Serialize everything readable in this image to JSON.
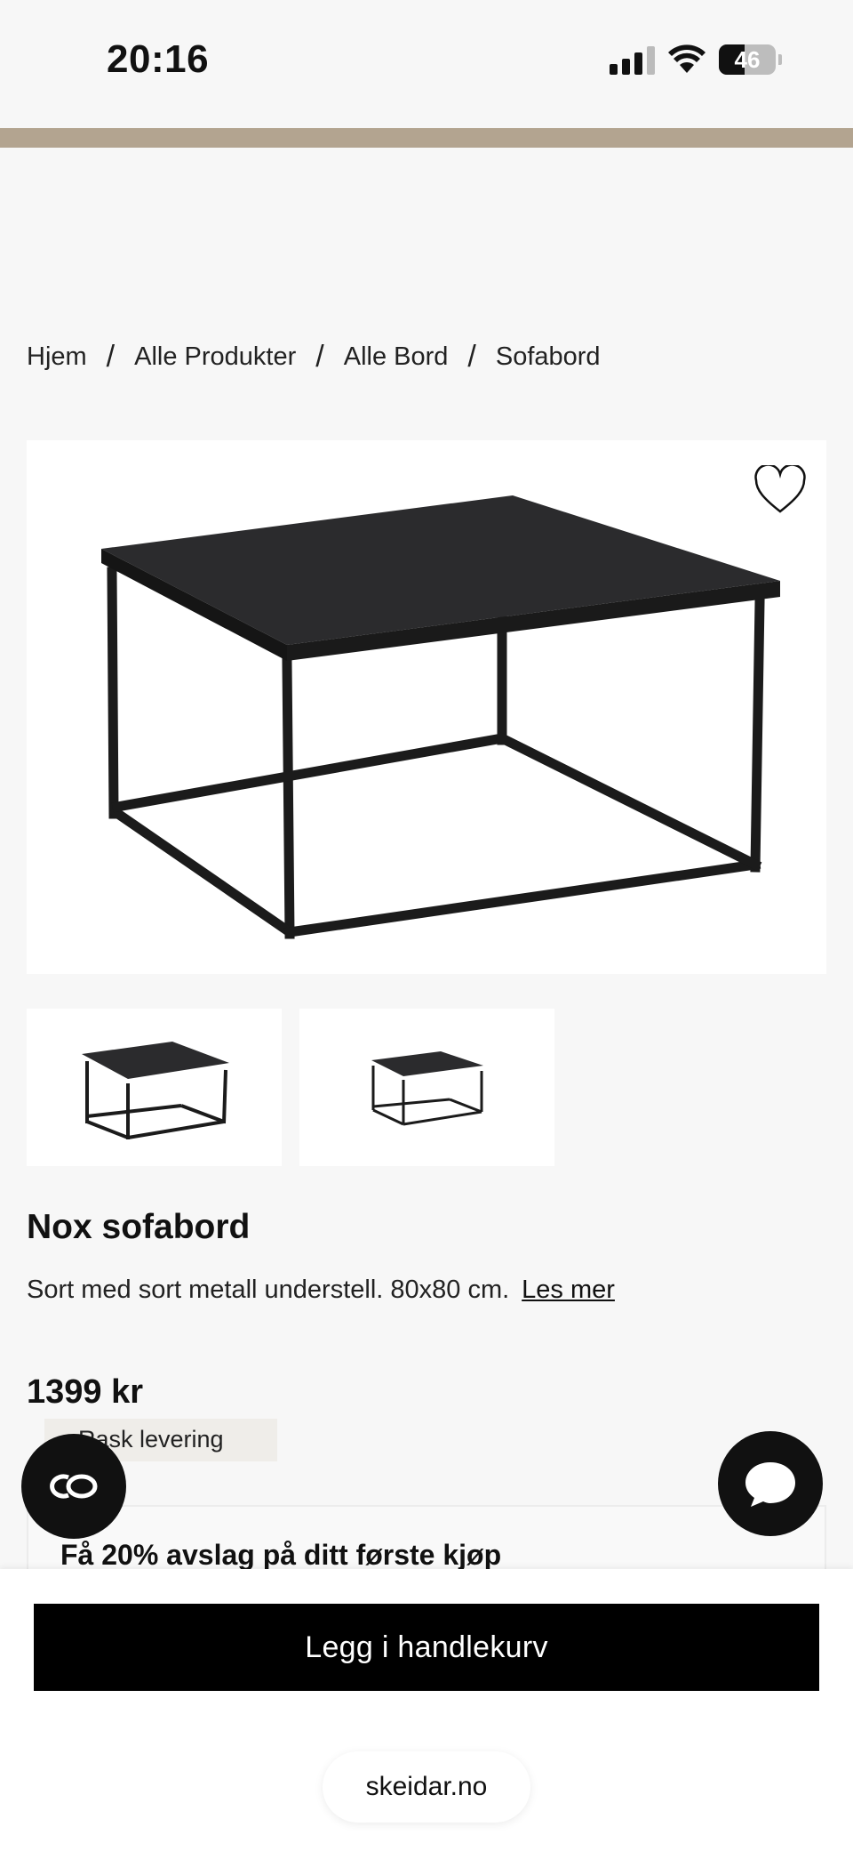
{
  "status_bar": {
    "time": "20:16",
    "battery_level": "46",
    "battery_fraction": 0.46,
    "signal_bars": 4,
    "signal_active": 3
  },
  "accent_color": "#b3a490",
  "breadcrumb": [
    {
      "label": "Hjem"
    },
    {
      "label": "Alle Produkter"
    },
    {
      "label": "Alle Bord"
    },
    {
      "label": "Sofabord"
    }
  ],
  "breadcrumb_separator": "/",
  "product": {
    "title": "Nox sofabord",
    "description": "Sort med sort metall understell. 80x80 cm.",
    "read_more": "Les mer",
    "price": "1399 kr",
    "delivery_badge": "Rask levering",
    "favorite_icon": "heart-outline-icon"
  },
  "promo": {
    "text": "Få 20% avslag på ditt første kjøp"
  },
  "floating": {
    "left_icon": "co-logo-icon",
    "right_icon": "chat-bubble-icon"
  },
  "cart": {
    "button_label": "Legg i handlekurv"
  },
  "browser": {
    "url": "skeidar.no"
  }
}
